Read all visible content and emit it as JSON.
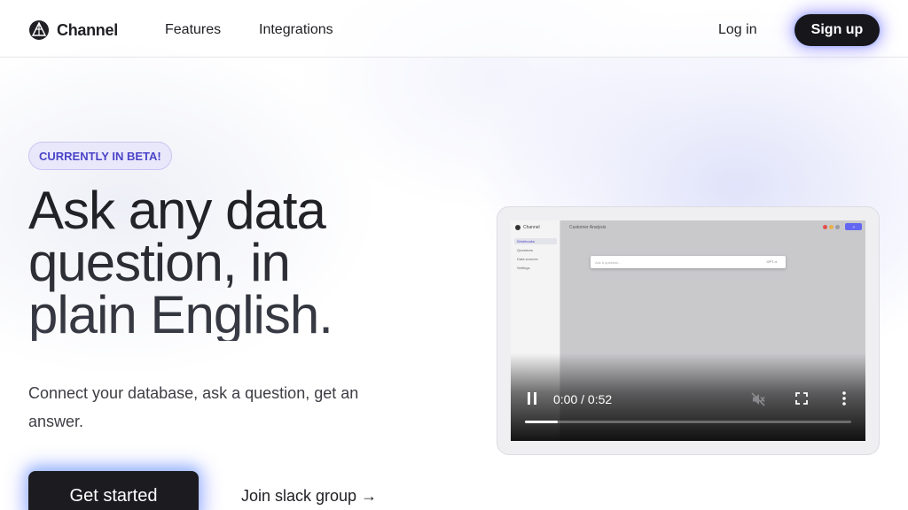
{
  "nav": {
    "brand": "Channel",
    "links": [
      "Features",
      "Integrations"
    ],
    "login": "Log in",
    "signup": "Sign up"
  },
  "hero": {
    "badge": "CURRENTLY IN BETA!",
    "headline_lines": [
      "Ask any data",
      "question, in",
      "plain English."
    ],
    "subtitle": "Connect your database, ask a question, get an answer.",
    "cta": "Get started",
    "secondary_link": "Join slack group →"
  },
  "video": {
    "time": "0:00 / 0:52",
    "progress_fraction": 0.1,
    "icons": [
      "pause-icon",
      "mute-icon",
      "fullscreen-icon",
      "more-vertical-icon"
    ],
    "app_preview": {
      "brand": "Channel",
      "title": "Customer Analysis",
      "nav_items": [
        "Workbooks",
        "Questions",
        "Data sources",
        "Settings"
      ],
      "search_placeholder": "Ask a question...",
      "model": "GPT-4"
    }
  },
  "colors": {
    "accent": "#4b44c8",
    "dark_button": "#16161b",
    "glow": "#7a6eff"
  }
}
